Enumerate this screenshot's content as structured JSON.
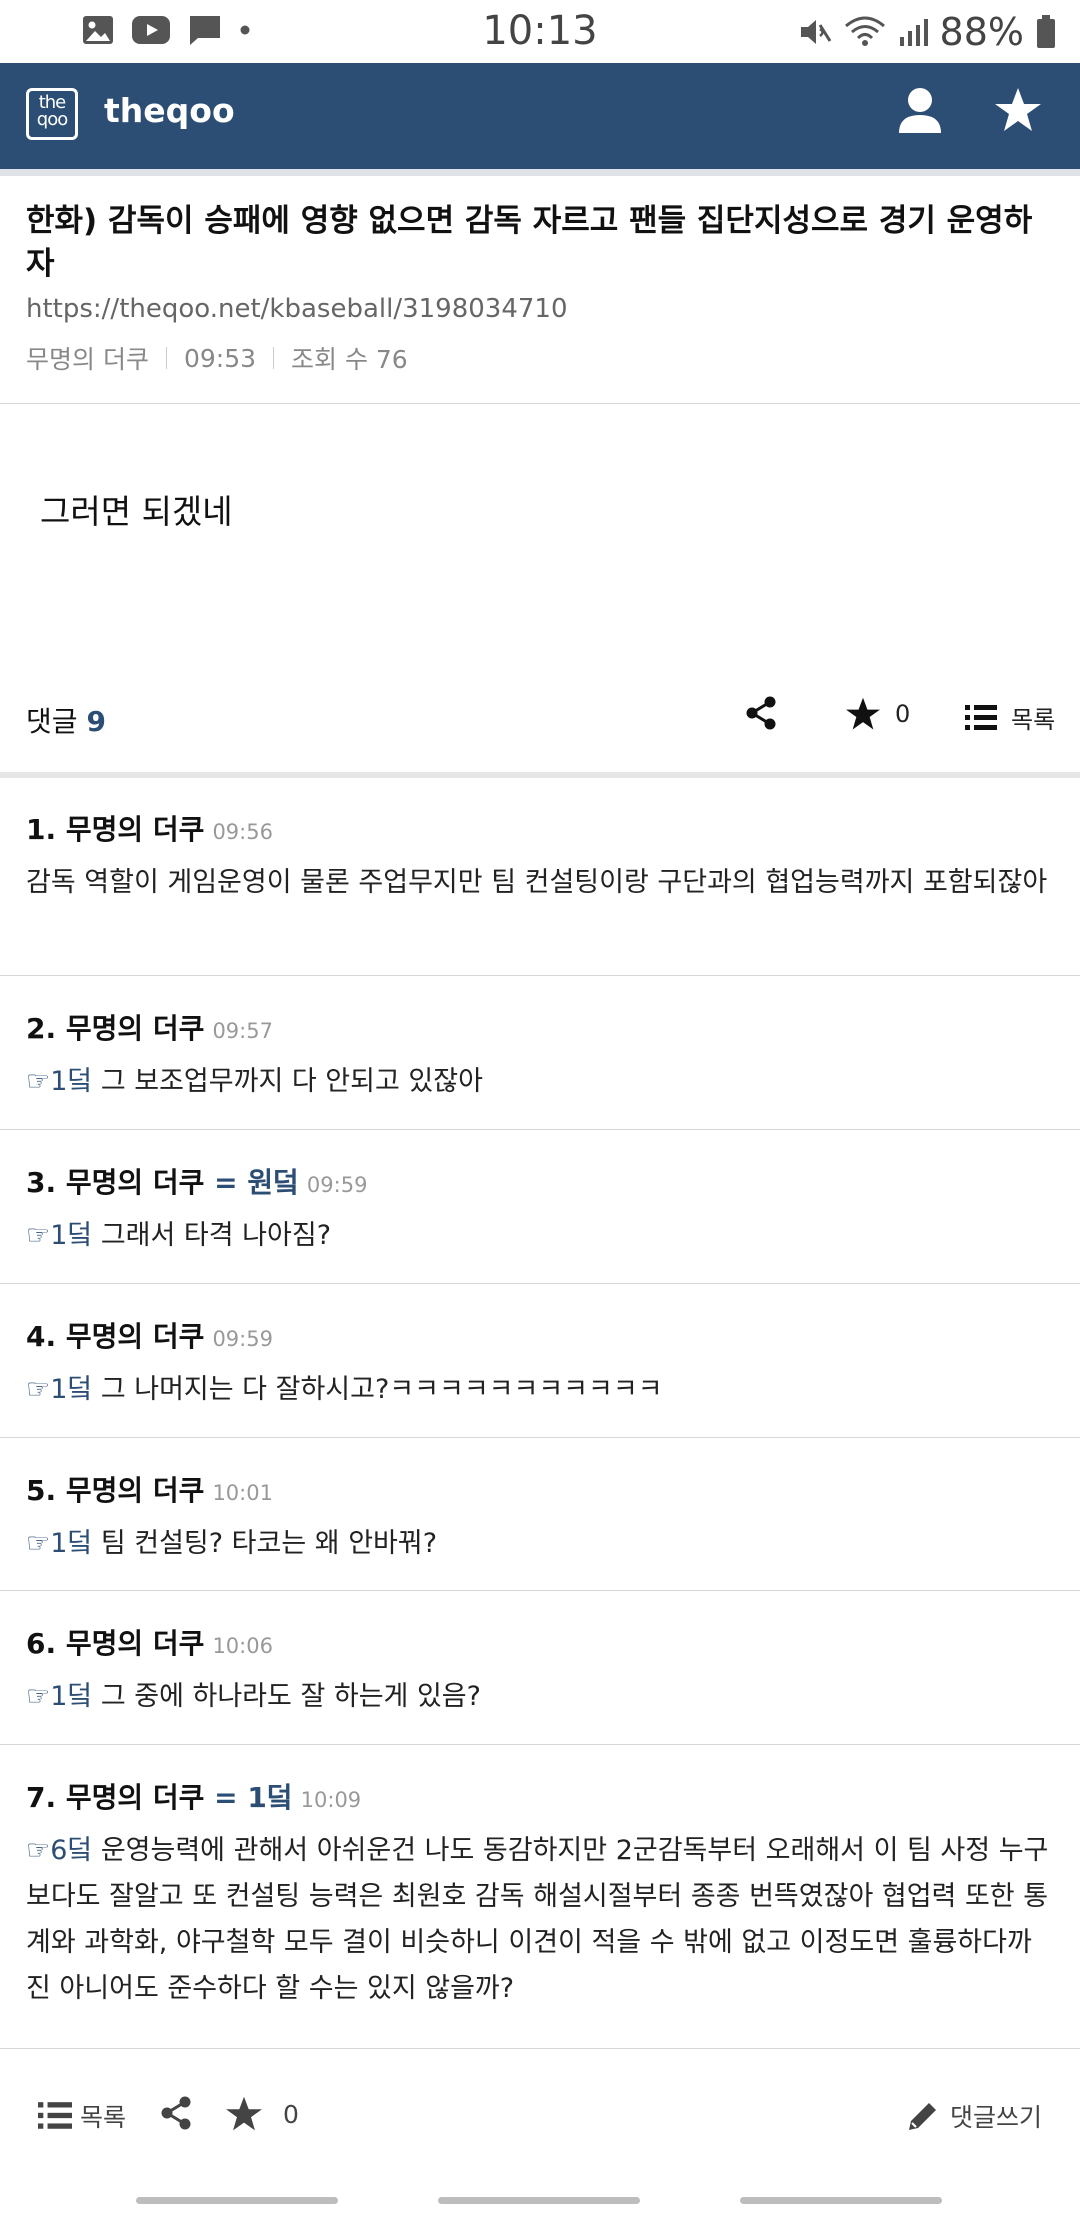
{
  "status_bar": {
    "time": "10:13",
    "battery": "88%",
    "icons": [
      "gallery-icon",
      "youtube-icon",
      "message-icon",
      "dot-icon",
      "mute-icon",
      "wifi-icon",
      "signal-icon",
      "battery-icon"
    ]
  },
  "header": {
    "logo_text_top": "the",
    "logo_text_bottom": "qoo",
    "brand": "theqoo",
    "accent_color": "#2c4e74"
  },
  "article": {
    "title": "한화) 감독이 승패에 영향 없으면 감독 자르고 팬들 집단지성으로 경기 운영하자",
    "url": "https://theqoo.net/kbaseball/3198034710",
    "author": "무명의 더쿠",
    "time": "09:53",
    "views": "조회 수 76",
    "body": "그러면 되겠네"
  },
  "actions": {
    "comments_label": "댓글",
    "comments_count": "9",
    "star_count": "0",
    "list_label": "목록"
  },
  "comments": [
    {
      "num": "1.",
      "author": "무명의 더쿠",
      "op": "",
      "time": "09:56",
      "ref": "",
      "text": "감독 역할이 게임운영이 물론 주업무지만 팀 컨설팅이랑 구단과의 협업능력까지 포함되잖아"
    },
    {
      "num": "2.",
      "author": "무명의 더쿠",
      "op": "",
      "time": "09:57",
      "ref": "☞1덬",
      "text": " 그 보조업무까지 다 안되고 있잖아"
    },
    {
      "num": "3.",
      "author": "무명의 더쿠",
      "op": " = 원덬",
      "time": "09:59",
      "ref": "☞1덬",
      "text": " 그래서 타격 나아짐?"
    },
    {
      "num": "4.",
      "author": "무명의 더쿠",
      "op": "",
      "time": "09:59",
      "ref": "☞1덬",
      "text": " 그 나머지는 다 잘하시고?ㅋㅋㅋㅋㅋㅋㅋㅋㅋㅋㅋ"
    },
    {
      "num": "5.",
      "author": "무명의 더쿠",
      "op": "",
      "time": "10:01",
      "ref": "☞1덬",
      "text": " 팀 컨설팅? 타코는 왜 안바꿔?"
    },
    {
      "num": "6.",
      "author": "무명의 더쿠",
      "op": "",
      "time": "10:06",
      "ref": "☞1덬",
      "text": " 그 중에 하나라도 잘 하는게 있음?"
    },
    {
      "num": "7.",
      "author": "무명의 더쿠",
      "op": " = 1덬",
      "time": "10:09",
      "ref": "☞6덬",
      "text": " 운영능력에 관해서 아쉬운건 나도 동감하지만 2군감독부터 오래해서 이 팀 사정 누구보다도 잘알고 또 컨설팅 능력은 최원호 감독 해설시절부터 종종 번뜩였잖아 협업력 또한 통계와 과학화, 야구철학 모두 결이 비슷하니 이견이 적을 수 밖에 없고 이정도면 훌륭하다까진 아니어도 준수하다 할 수는 있지 않을까?"
    }
  ],
  "bottom_bar": {
    "list_label": "목록",
    "star_count": "0",
    "write_label": "댓글쓰기"
  }
}
